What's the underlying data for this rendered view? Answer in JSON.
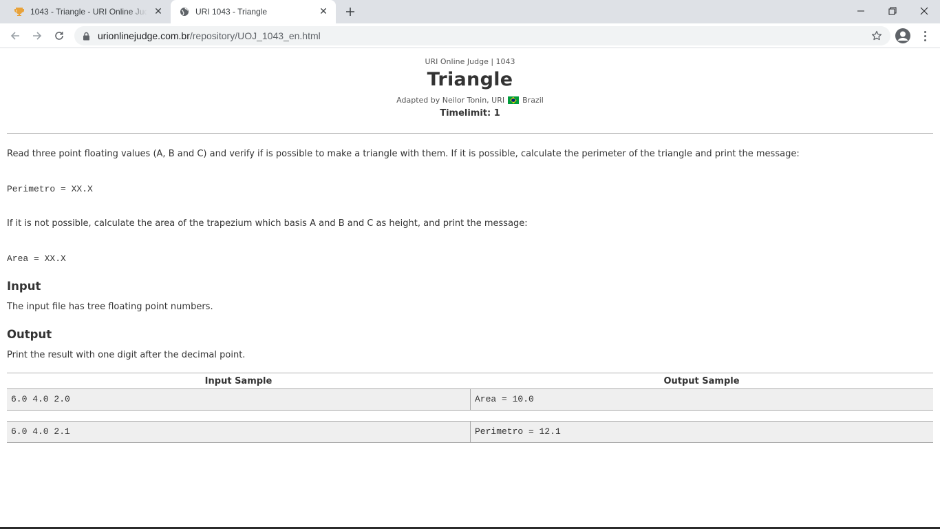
{
  "browser": {
    "tabs": [
      {
        "title": "1043 - Triangle - URI Online Judge",
        "favicon": "trophy-icon",
        "active": false
      },
      {
        "title": "URI 1043 - Triangle",
        "favicon": "globe-icon",
        "active": true
      }
    ],
    "url_host": "urionlinejudge.com.br",
    "url_path": "/repository/UOJ_1043_en.html"
  },
  "problem": {
    "site": "URI Online Judge | 1043",
    "title": "Triangle",
    "author_prefix": "Adapted by Neilor Tonin, URI",
    "country": "Brazil",
    "timelimit": "Timelimit: 1",
    "description_1": "Read three point floating values (A, B and C) and verify if is possible to make a triangle with them. If it is possible, calculate the perimeter of the triangle and print the message:",
    "code_1": "Perimetro = XX.X",
    "description_2": "If it is not possible, calculate the area of the trapezium which basis A and B and C as height, and print the message:",
    "code_2": "Area = XX.X",
    "input_heading": "Input",
    "input_text": "The input file has tree floating point numbers.",
    "output_heading": "Output",
    "output_text": "Print the result with one digit after the decimal point."
  },
  "samples": {
    "input_header": "Input Sample",
    "output_header": "Output Sample",
    "rows": [
      {
        "input": "6.0 4.0 2.0",
        "output": "Area = 10.0"
      },
      {
        "input": "6.0 4.0 2.1",
        "output": "Perimetro = 12.1"
      }
    ]
  }
}
